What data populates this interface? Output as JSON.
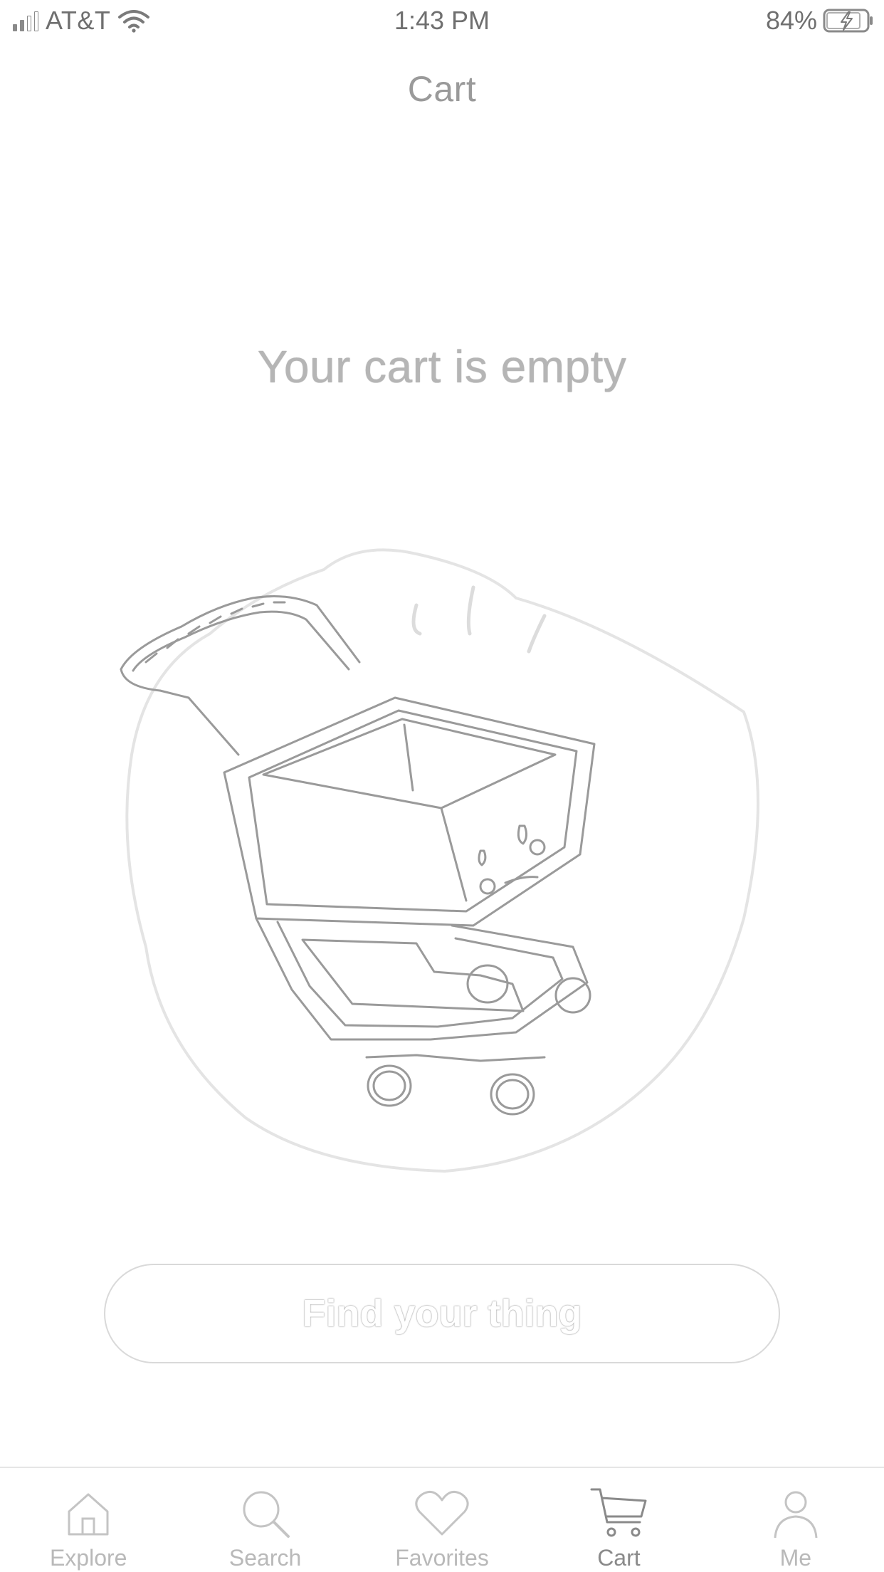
{
  "status_bar": {
    "carrier": "AT&T",
    "time": "1:43 PM",
    "battery": "84%"
  },
  "nav": {
    "title": "Cart"
  },
  "empty_state": {
    "heading": "Your cart is empty",
    "button_label": "Find your thing",
    "illustration_icon": "sad-shopping-cart-icon"
  },
  "tab_bar": {
    "tabs": [
      {
        "label": "Explore",
        "icon": "home-icon",
        "active": false
      },
      {
        "label": "Search",
        "icon": "search-icon",
        "active": false
      },
      {
        "label": "Favorites",
        "icon": "heart-icon",
        "active": false
      },
      {
        "label": "Cart",
        "icon": "cart-icon",
        "active": true
      },
      {
        "label": "Me",
        "icon": "person-icon",
        "active": false
      }
    ]
  },
  "colors": {
    "text_primary": "#8e8e8e",
    "text_faint": "#b9b9b9",
    "outline": "#d9d9d9"
  }
}
